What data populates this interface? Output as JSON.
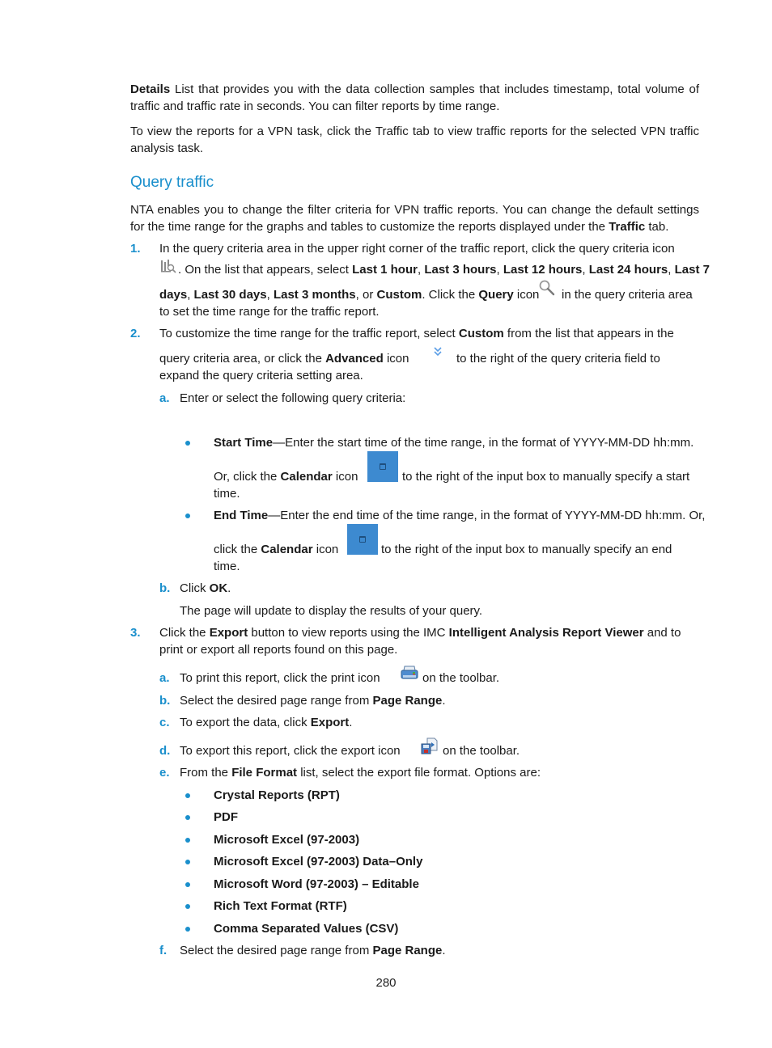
{
  "intro": {
    "details_term": "Details",
    "details_text": " List that provides you with the data collection samples that includes timestamp, total volume of traffic and traffic rate in seconds. You can filter reports by time range.",
    "vpn_text": "To view the reports for a VPN task, click the Traffic tab to view traffic reports for the selected VPN traffic analysis task."
  },
  "section": {
    "title": "Query traffic",
    "intro_part1": "NTA enables you to change the filter criteria for VPN traffic reports. You can change the default settings for the time range for the graphs and tables to customize the reports displayed under the ",
    "intro_bold": "Traffic",
    "intro_part2": " tab."
  },
  "steps": {
    "s1": {
      "num": "1.",
      "line1": "In the query criteria area in the upper right corner of the traffic report, click the query criteria icon",
      "l2_a": ". On the list that appears, select ",
      "opt1": "Last 1 hour",
      "sep": ", ",
      "opt2": "Last 3 hours",
      "opt3": "Last 12 hours",
      "opt4": "Last 24 hours",
      "opt5a": "Last 7",
      "opt5b": "days",
      "opt6": "Last 30 days",
      "opt7": "Last 3 months",
      "or": ", or ",
      "opt8": "Custom",
      "click_the": ". Click the ",
      "query_bold": "Query",
      "icon_word": " icon",
      "l3_tail": "in the query criteria area",
      "line4": "to set the time range for the traffic report."
    },
    "s2": {
      "num": "2.",
      "l1_a": "To customize the time range for the traffic report, select ",
      "custom_bold": "Custom",
      "l1_b": " from the list that appears in the",
      "l2_a": "query criteria area, or click the ",
      "advanced_bold": "Advanced",
      "l2_b": " icon",
      "l2_c": "to the right of the query criteria field to",
      "line3": "expand the query criteria setting area.",
      "a_letter": "a.",
      "a_text": "Enter or select the following query criteria:",
      "start_bold": "Start Time",
      "start_text": "—Enter the start time of the time range, in the format of YYYY-MM-DD hh:mm.",
      "start_l2a": "Or, click the ",
      "calendar_bold": "Calendar",
      "start_l2b": " icon",
      "start_l2c": "to the right of the input box to manually specify a start",
      "start_l3": "time.",
      "end_bold": "End Time",
      "end_text": "—Enter the end time of the time range, in the format of YYYY-MM-DD hh:mm. Or,",
      "end_l2a": "click the ",
      "end_l2b": " icon",
      "end_l2c": "to the right of the input box to manually specify an end",
      "end_l3": "time.",
      "b_letter": "b.",
      "b_text_a": "Click ",
      "ok_bold": "OK",
      "b_text_b": ".",
      "b_result": "The page will update to display the results of your query."
    },
    "s3": {
      "num": "3.",
      "l1_a": "Click the ",
      "export_bold": "Export",
      "l1_b": " button to view reports using the IMC ",
      "viewer_bold": "Intelligent Analysis Report Viewer",
      "l1_c": " and to",
      "line2": "print or export all reports found on this page.",
      "a_letter": "a.",
      "a_text": "To print this report, click the print icon",
      "a_tail": "on the toolbar.",
      "b_letter": "b.",
      "b_text": "Select the desired page range from ",
      "page_range_bold": "Page Range",
      "period": ".",
      "c_letter": "c.",
      "c_text": "To export the data, click ",
      "export_bold2": "Export",
      "d_letter": "d.",
      "d_text": "To export this report, click the export icon",
      "d_tail": "on the toolbar.",
      "e_letter": "e.",
      "e_text_a": "From the ",
      "file_format_bold": "File Format",
      "e_text_b": " list, select the export file format. Options are:",
      "formats": [
        "Crystal Reports (RPT)",
        "PDF",
        "Microsoft Excel (97-2003)",
        "Microsoft Excel (97-2003) Data–Only",
        "Microsoft Word (97-2003) – Editable",
        "Rich Text Format (RTF)",
        "Comma Separated Values (CSV)"
      ],
      "f_letter": "f.",
      "f_text": "Select the desired page range from "
    }
  },
  "icons": {
    "query_criteria": "query-criteria-icon",
    "query": "magnifier-search-icon",
    "advanced": "double-chevron-down-icon",
    "calendar": "calendar-icon",
    "print": "printer-icon",
    "export": "export-floppy-icon"
  },
  "colors": {
    "accent": "#1a8fcc",
    "calendar_button": "#3d8ad0"
  },
  "footer": {
    "page_number": "280"
  }
}
